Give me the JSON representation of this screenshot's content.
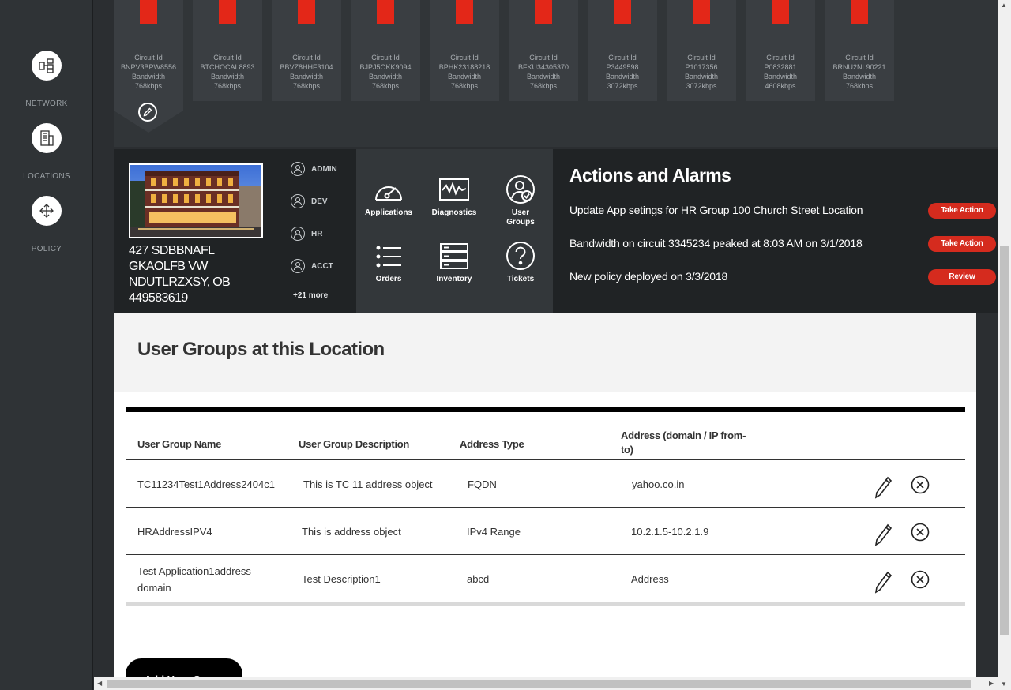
{
  "nav": {
    "items": [
      {
        "label": "NETWORK",
        "icon": "network-icon"
      },
      {
        "label": "LOCATIONS",
        "icon": "building-icon"
      },
      {
        "label": "POLICY",
        "icon": "move-arrows-icon"
      }
    ]
  },
  "circuits": [
    {
      "id_label": "Circuit Id",
      "id": "BNPV3BPW8556",
      "bw_label": "Bandwidth",
      "bw": "768kbps"
    },
    {
      "id_label": "Circuit Id",
      "id": "BTCHOCAL8893",
      "bw_label": "Bandwidth",
      "bw": "768kbps"
    },
    {
      "id_label": "Circuit Id",
      "id": "BBVZ8HHF3104",
      "bw_label": "Bandwidth",
      "bw": "768kbps"
    },
    {
      "id_label": "Circuit Id",
      "id": "BJPJ5OKK9094",
      "bw_label": "Bandwidth",
      "bw": "768kbps"
    },
    {
      "id_label": "Circuit Id",
      "id": "BPHK23188218",
      "bw_label": "Bandwidth",
      "bw": "768kbps"
    },
    {
      "id_label": "Circuit Id",
      "id": "BFKU34305370",
      "bw_label": "Bandwidth",
      "bw": "768kbps"
    },
    {
      "id_label": "Circuit Id",
      "id": "P3449598",
      "bw_label": "Bandwidth",
      "bw": "3072kbps"
    },
    {
      "id_label": "Circuit Id",
      "id": "P1017356",
      "bw_label": "Bandwidth",
      "bw": "3072kbps"
    },
    {
      "id_label": "Circuit Id",
      "id": "P0832881",
      "bw_label": "Bandwidth",
      "bw": "4608kbps"
    },
    {
      "id_label": "Circuit Id",
      "id": "BRNU2NL90221",
      "bw_label": "Bandwidth",
      "bw": "768kbps"
    }
  ],
  "location": {
    "address_lines": [
      "427 SDBBNAFL",
      "GKAOLFB VW",
      "NDUTLRZXSY, OB",
      "449583619"
    ],
    "roles": [
      "ADMIN",
      "DEV",
      "HR",
      "ACCT"
    ],
    "more": "+21 more"
  },
  "tools": [
    {
      "label": "Applications",
      "icon": "speedometer-icon"
    },
    {
      "label": "Diagnostics",
      "icon": "waveform-icon"
    },
    {
      "label": "User Groups",
      "icon": "user-check-icon"
    },
    {
      "label": "Orders",
      "icon": "list-icon"
    },
    {
      "label": "Inventory",
      "icon": "server-icon"
    },
    {
      "label": "Tickets",
      "icon": "question-icon"
    }
  ],
  "actions": {
    "title": "Actions and Alarms",
    "items": [
      {
        "text": "Update App setings for HR Group 100 Church Street Location",
        "button": "Take Action"
      },
      {
        "text": "Bandwidth on circuit 3345234 peaked at 8:03 AM on 3/1/2018",
        "button": "Take Action"
      },
      {
        "text": "New policy deployed on 3/3/2018",
        "button": "Review"
      }
    ]
  },
  "user_groups": {
    "title": "User Groups at this Location",
    "columns": [
      "User Group Name",
      "User Group Description",
      "Address Type",
      "Address (domain / IP from-to)"
    ],
    "column_lines": [
      [
        "User Group Name"
      ],
      [
        "User Group Description"
      ],
      [
        "Address Type"
      ],
      [
        "Address (domain / IP from-",
        "to)"
      ]
    ],
    "rows": [
      {
        "name": [
          "TC11234Test1Address2404c1"
        ],
        "description": "This is TC 11 address object",
        "type": "FQDN",
        "address": "yahoo.co.in"
      },
      {
        "name": [
          "HRAddressIPV4"
        ],
        "description": "This is address object",
        "type": "IPv4 Range",
        "address": "10.2.1.5-10.2.1.9"
      },
      {
        "name": [
          "Test Application1address",
          "domain"
        ],
        "description": "Test Description1",
        "type": "abcd",
        "address": "Address"
      }
    ],
    "add_button": "Add User Group"
  },
  "colors": {
    "accent_red": "#e32718",
    "button_red": "#d52b1e",
    "dark_panel": "#202325"
  }
}
